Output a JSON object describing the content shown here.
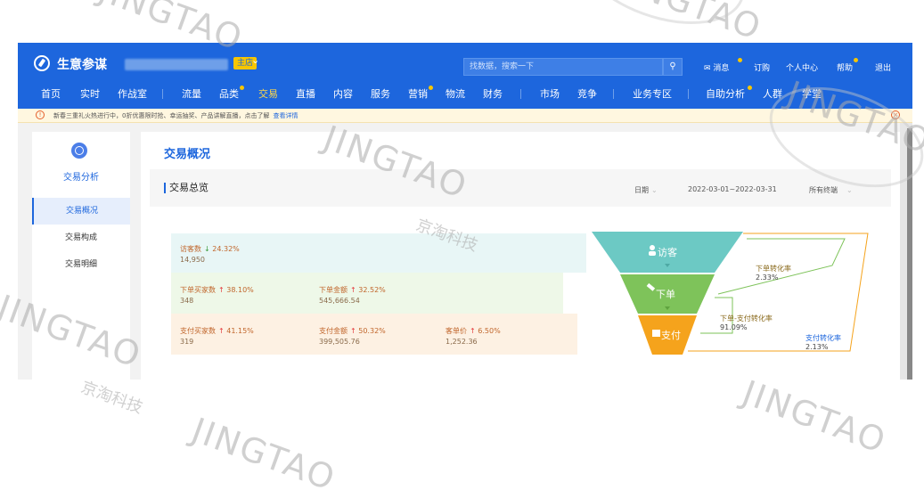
{
  "header": {
    "logo": "生意参谋",
    "store_badge": "主店",
    "search_placeholder": "找数据，搜索一下",
    "links": {
      "messages": "消息",
      "subscribe": "订购",
      "profile": "个人中心",
      "help": "帮助",
      "logout": "退出"
    }
  },
  "nav": {
    "items": [
      "首页",
      "实时",
      "作战室",
      "流量",
      "品类",
      "交易",
      "直播",
      "内容",
      "服务",
      "营销",
      "物流",
      "财务",
      "市场",
      "竞争",
      "业务专区",
      "自助分析",
      "人群",
      "学堂"
    ],
    "active": "交易"
  },
  "notice": {
    "text": "新春三重礼火热进行中，0折优惠限时抢、幸运抽奖、产品讲解直播，点击了解",
    "link": "查看详情"
  },
  "sidebar": {
    "title": "交易分析",
    "items": [
      "交易概况",
      "交易构成",
      "交易明细"
    ]
  },
  "main": {
    "title": "交易概况",
    "section_title": "交易总览",
    "date_label": "日期",
    "date_range": "2022-03-01~2022-03-31",
    "terminal": "所有终端"
  },
  "metrics": {
    "visitors": {
      "label": "访客数",
      "change": "24.32%",
      "value": "14,950"
    },
    "order_buyers": {
      "label": "下单买家数",
      "change": "38.10%",
      "value": "348"
    },
    "order_amount": {
      "label": "下单金额",
      "change": "32.52%",
      "value": "545,666.54"
    },
    "paid_buyers": {
      "label": "支付买家数",
      "change": "41.15%",
      "value": "319"
    },
    "paid_amount": {
      "label": "支付金额",
      "change": "50.32%",
      "value": "399,505.76"
    },
    "avg_price": {
      "label": "客单价",
      "change": "6.50%",
      "value": "1,252.36"
    }
  },
  "funnel": {
    "stage1": "访客",
    "stage2": "下单",
    "stage3": "支付",
    "rate_order": {
      "label": "下单转化率",
      "value": "2.33%"
    },
    "rate_order_pay": {
      "label": "下单-支付转化率",
      "value": "91.09%"
    },
    "rate_pay": {
      "label": "支付转化率",
      "value": "2.13%"
    }
  },
  "watermark": {
    "latin": "JINGTAO",
    "cn": "京淘科技"
  },
  "colors": {
    "brand": "#1d66dd",
    "funnel_top": "#6cc9c4",
    "funnel_mid": "#7ec35a",
    "funnel_bottom": "#f5a31c"
  }
}
